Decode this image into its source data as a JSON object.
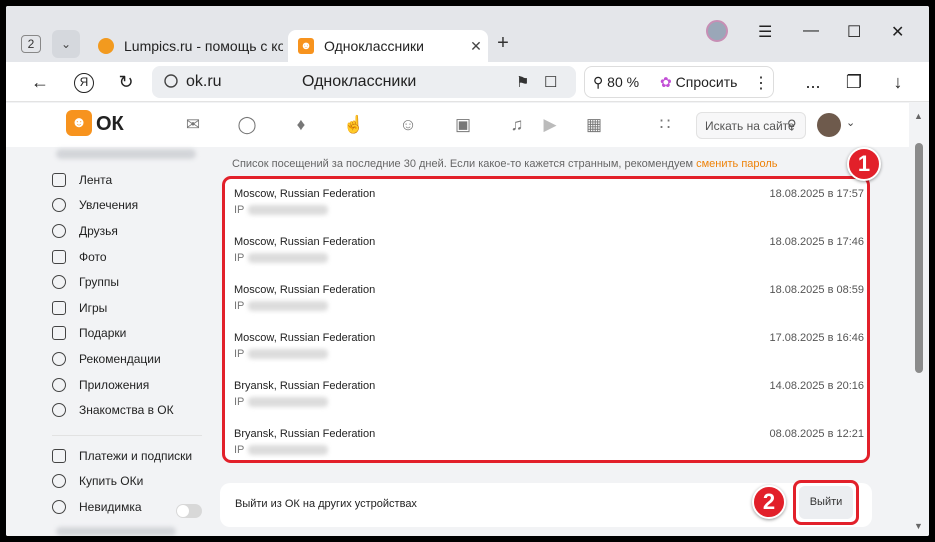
{
  "tabstrip": {
    "tab_count": "2",
    "tabs": [
      {
        "label": "Lumpics.ru - помощь с ком",
        "active": false
      },
      {
        "label": "Одноклассники",
        "active": true
      }
    ]
  },
  "address_bar": {
    "host": "ok.ru",
    "page_title": "Одноклассники",
    "zoom": "80 %",
    "ask_label": "Спросить",
    "menu_more": "..."
  },
  "ok_header": {
    "brand": "ОК",
    "search_placeholder": "Искать на сайте"
  },
  "sidebar": {
    "items": [
      {
        "label": "Лента"
      },
      {
        "label": "Увлечения"
      },
      {
        "label": "Друзья"
      },
      {
        "label": "Фото"
      },
      {
        "label": "Группы"
      },
      {
        "label": "Игры"
      },
      {
        "label": "Подарки"
      },
      {
        "label": "Рекомендации"
      },
      {
        "label": "Приложения"
      },
      {
        "label": "Знакомства в ОК"
      },
      {
        "label": "Платежи и подписки"
      },
      {
        "label": "Купить ОКи"
      },
      {
        "label": "Невидимка"
      }
    ]
  },
  "main": {
    "notice_text": "Список посещений за последние 30 дней. Если какое-то кажется странным, рекомендуем",
    "notice_link": "сменить пароль",
    "sessions": [
      {
        "location": "Moscow, Russian Federation",
        "ip_label": "IP",
        "date": "18.08.2025 в 17:57"
      },
      {
        "location": "Moscow, Russian Federation",
        "ip_label": "IP",
        "date": "18.08.2025 в 17:46"
      },
      {
        "location": "Moscow, Russian Federation",
        "ip_label": "IP",
        "date": "18.08.2025 в 08:59"
      },
      {
        "location": "Moscow, Russian Federation",
        "ip_label": "IP",
        "date": "17.08.2025 в 16:46"
      },
      {
        "location": "Bryansk, Russian Federation",
        "ip_label": "IP",
        "date": "14.08.2025 в 20:16"
      },
      {
        "location": "Bryansk, Russian Federation",
        "ip_label": "IP",
        "date": "08.08.2025 в 12:21"
      }
    ],
    "exit_text": "Выйти из ОК на других устройствах",
    "exit_button": "Выйти"
  },
  "annotations": {
    "badge_1": "1",
    "badge_2": "2"
  },
  "colors": {
    "accent": "#f7931e",
    "highlight": "#e2202a",
    "link": "#ee8208"
  }
}
